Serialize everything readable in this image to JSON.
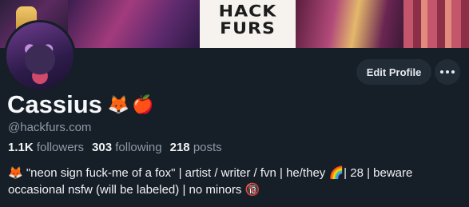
{
  "banner": {
    "text": "HACK\nFURS"
  },
  "profile": {
    "display_name": "Cassius",
    "name_emojis": [
      "🦊",
      "🍎"
    ],
    "handle": "@hackfurs.com",
    "stats": {
      "followers_count": "1.1K",
      "followers_label": "followers",
      "following_count": "303",
      "following_label": "following",
      "posts_count": "218",
      "posts_label": "posts"
    },
    "bio_line1": "\"neon sign fuck-me of a fox\" | artist / writer / fvn | he/they",
    "bio_line1_end": "| 28 | beware",
    "bio_line2": "occasional nsfw (will be labeled) | no minors",
    "bio_icons": {
      "lead": "🦊",
      "rainbow": "🌈",
      "no_minors": "🔞"
    }
  },
  "actions": {
    "edit_label": "Edit Profile",
    "more_label": "more-options"
  },
  "colors": {
    "background": "#161e27",
    "button_bg": "#222c37",
    "muted_text": "#8e9aa7"
  }
}
